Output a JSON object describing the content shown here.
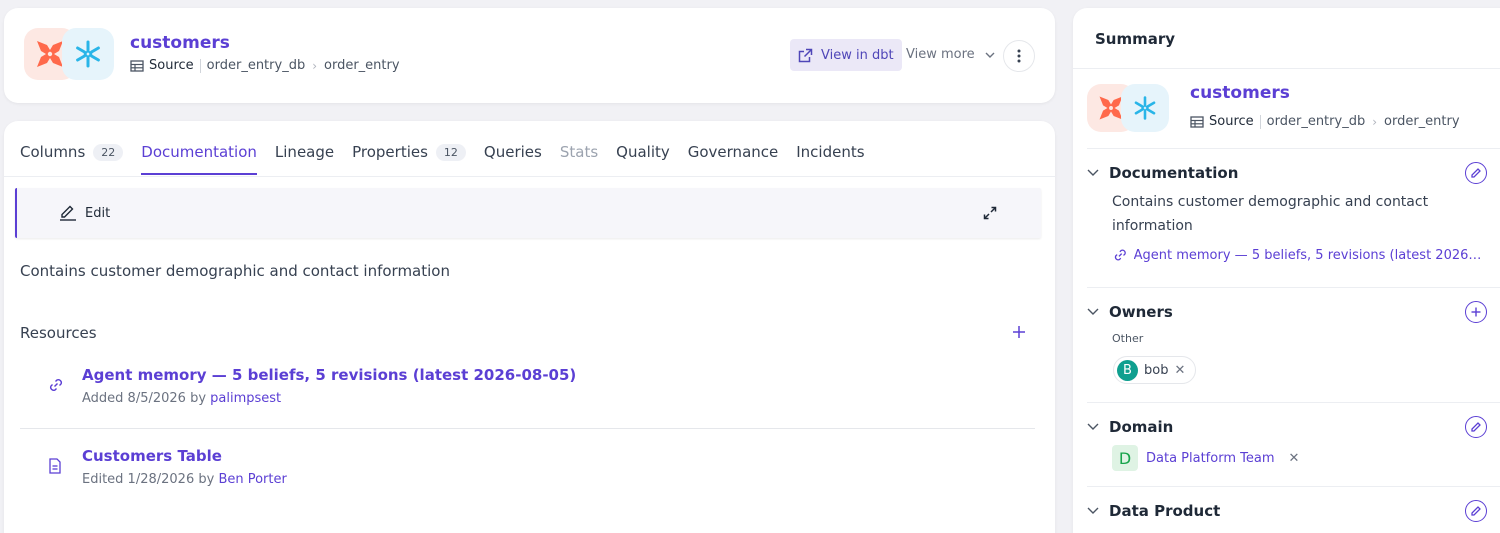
{
  "header": {
    "entity_name": "customers",
    "type_label": "Source",
    "breadcrumb": [
      "order_entry_db",
      "order_entry"
    ],
    "view_in_dbt": "View in dbt",
    "view_more": "View more"
  },
  "tabs": [
    {
      "label": "Columns",
      "count": "22"
    },
    {
      "label": "Documentation"
    },
    {
      "label": "Lineage"
    },
    {
      "label": "Properties",
      "count": "12"
    },
    {
      "label": "Queries"
    },
    {
      "label": "Stats"
    },
    {
      "label": "Quality"
    },
    {
      "label": "Governance"
    },
    {
      "label": "Incidents"
    }
  ],
  "documentation": {
    "edit_label": "Edit",
    "description": "Contains customer demographic and contact information"
  },
  "resources": {
    "title": "Resources",
    "items": [
      {
        "title": "Agent memory — 5 beliefs, 5 revisions (latest 2026-08-05)",
        "meta_prefix": "Added 8/5/2026 by ",
        "author": "palimpsest",
        "icon": "link-icon"
      },
      {
        "title": "Customers Table",
        "meta_prefix": "Edited 1/28/2026 by ",
        "author": "Ben Porter",
        "icon": "document-icon"
      }
    ]
  },
  "summary": {
    "title": "Summary",
    "entity_name": "customers",
    "type_label": "Source",
    "breadcrumb": [
      "order_entry_db",
      "order_entry"
    ],
    "documentation": {
      "heading": "Documentation",
      "description": "Contains customer demographic and contact information",
      "link": "Agent memory — 5 beliefs, 5 revisions (latest 2026-08-05)"
    },
    "owners": {
      "heading": "Owners",
      "group": "Other",
      "owner_initial": "B",
      "owner_name": "bob"
    },
    "domain": {
      "heading": "Domain",
      "initial": "D",
      "name": "Data Platform Team"
    },
    "data_product": {
      "heading": "Data Product"
    }
  },
  "colors": {
    "accent": "#5b3fd4",
    "dbt_orange": "#ff694b",
    "snowflake_blue": "#29b5e8"
  }
}
